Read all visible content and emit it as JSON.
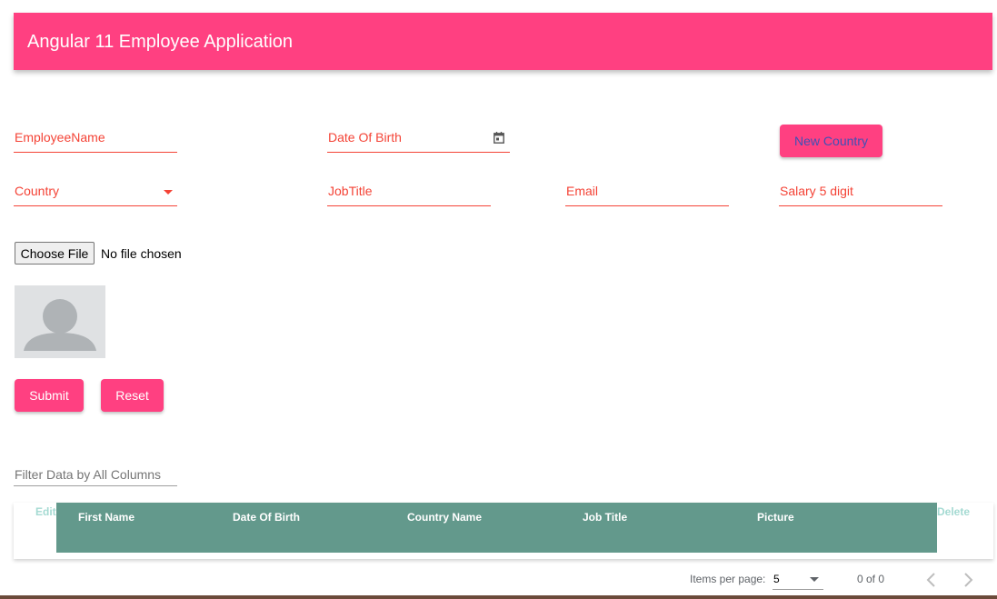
{
  "toolbar": {
    "title": "Angular 11 Employee Application"
  },
  "form": {
    "employee_name": "EmployeeName",
    "date_of_birth": "Date Of Birth",
    "new_country_button": "New Country",
    "country": "Country",
    "job_title": "JobTitle",
    "email": "Email",
    "salary": "Salary 5 digit",
    "choose_file": "Choose File",
    "file_status": "No file chosen",
    "submit": "Submit",
    "reset": "Reset"
  },
  "filter": {
    "label": "Filter Data by All Columns"
  },
  "table": {
    "edit": "Edit",
    "delete": "Delete",
    "columns": [
      "First Name",
      "Date Of Birth",
      "Country Name",
      "Job Title",
      "Picture"
    ]
  },
  "paginator": {
    "items_per_page_label": "Items per page:",
    "page_size": "5",
    "range": "0 of 0"
  },
  "colors": {
    "accent": "#ff4081",
    "warn": "#f44336",
    "table_header": "#63998c"
  },
  "icons": {
    "calendar": "calendar-icon",
    "dropdown": "chevron-down-icon",
    "avatar": "user-placeholder-icon",
    "prev": "chevron-left-icon",
    "next": "chevron-right-icon"
  }
}
